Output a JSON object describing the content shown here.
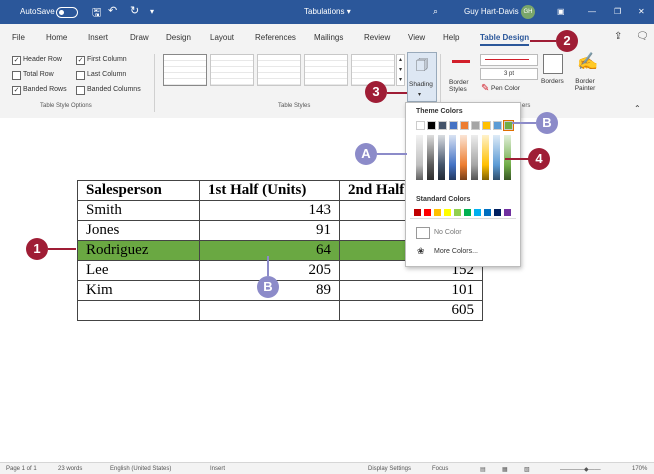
{
  "titlebar": {
    "autosave": "AutoSave",
    "autosave_state": "Off",
    "doc_title": "Tabulations ▾",
    "user": "Guy Hart-Davis",
    "initials": "GH"
  },
  "menu": [
    "File",
    "Home",
    "Insert",
    "Draw",
    "Design",
    "Layout",
    "References",
    "Mailings",
    "Review",
    "View",
    "Help",
    "Table Design"
  ],
  "ribbon": {
    "options": [
      {
        "label": "Header Row",
        "checked": true
      },
      {
        "label": "First Column",
        "checked": true
      },
      {
        "label": "Total Row",
        "checked": false
      },
      {
        "label": "Last Column",
        "checked": false
      },
      {
        "label": "Banded Rows",
        "checked": true
      },
      {
        "label": "Banded Columns",
        "checked": false
      }
    ],
    "group_options": "Table Style Options",
    "group_styles": "Table Styles",
    "shading": "Shading",
    "border_styles": "Border Styles",
    "pen_weight": "3 pt",
    "pen_color": "Pen Color",
    "borders": "Borders",
    "border_painter": "Border Painter",
    "group_borders": "ers"
  },
  "table": {
    "header": [
      "Salesperson",
      "1st Half (Units)",
      "2nd Half"
    ],
    "rows": [
      [
        "Smith",
        "143",
        ""
      ],
      [
        "Jones",
        "91",
        ""
      ],
      [
        "Rodriguez",
        "64",
        ""
      ],
      [
        "Lee",
        "205",
        "152"
      ],
      [
        "Kim",
        "89",
        "101"
      ],
      [
        "",
        "",
        "605"
      ]
    ]
  },
  "color_menu": {
    "theme_label": "Theme Colors",
    "standard_label": "Standard Colors",
    "no_color": "No Color",
    "more_colors": "More Colors...",
    "theme_colors": [
      "#ffffff",
      "#000000",
      "#44546a",
      "#4472c4",
      "#ed7d31",
      "#a5a5a5",
      "#ffc000",
      "#5b9bd5",
      "#70ad47"
    ],
    "standard_colors": [
      "#c00000",
      "#ff0000",
      "#ffc000",
      "#ffff00",
      "#92d050",
      "#00b050",
      "#00b0f0",
      "#0070c0",
      "#002060",
      "#7030a0"
    ],
    "highlight_color": "#6aa842"
  },
  "callouts": [
    "1",
    "2",
    "3",
    "4",
    "A",
    "B",
    "B"
  ],
  "status": {
    "page": "Page 1 of 1",
    "words": "23 words",
    "language": "English (United States)",
    "mode": "Insert",
    "display": "Display Settings",
    "focus": "Focus",
    "zoom": "170%"
  }
}
